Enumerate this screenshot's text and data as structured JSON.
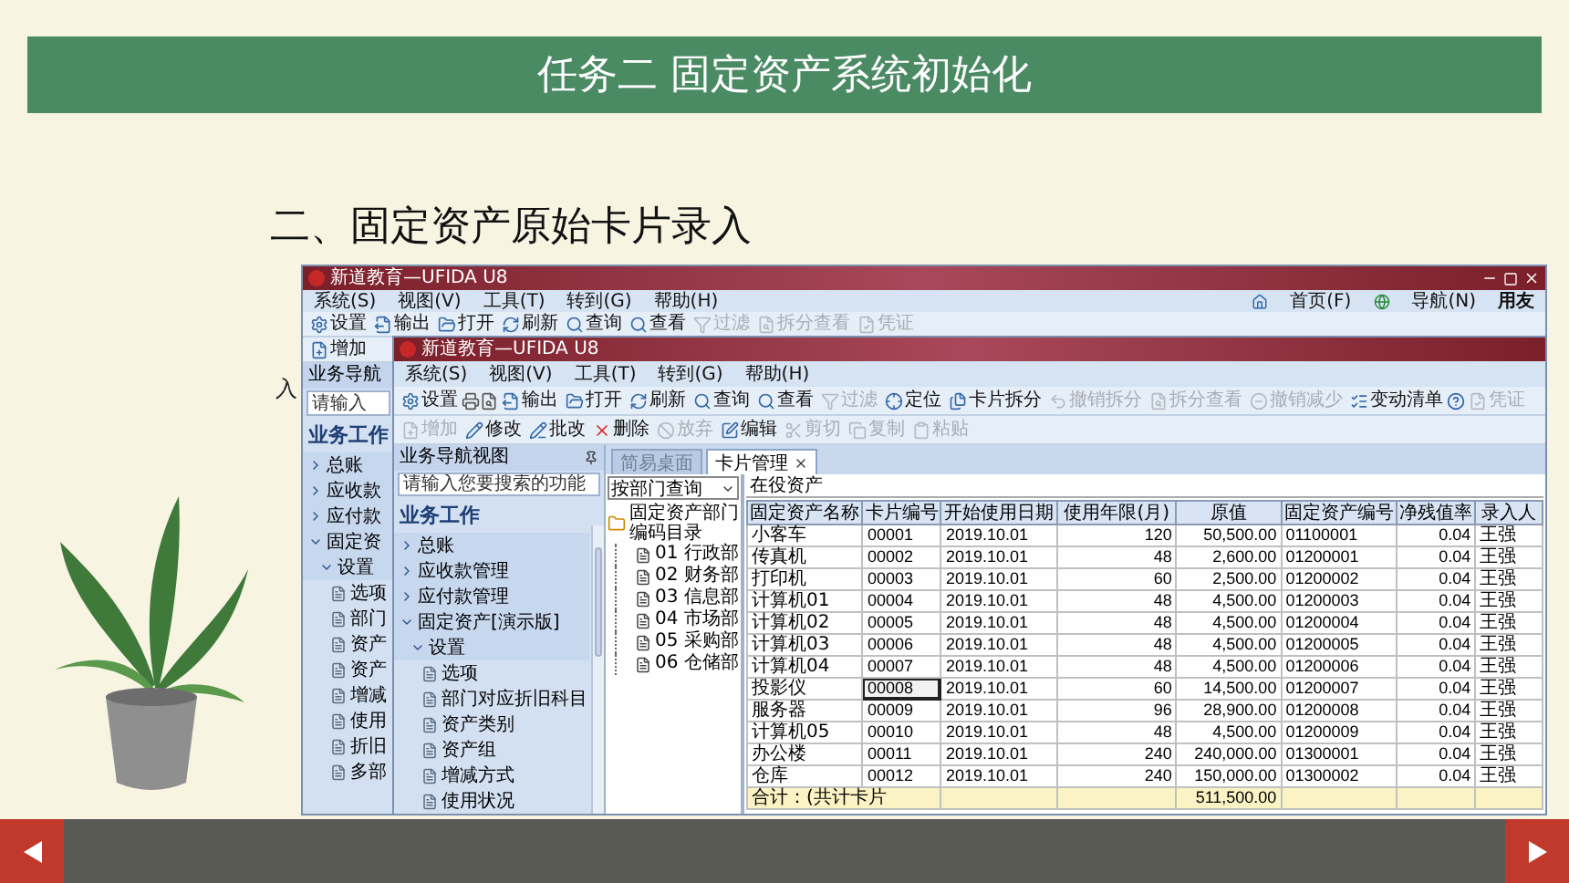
{
  "slide": {
    "title": "任务二 固定资产系统初始化",
    "heading": "二、固定资产原始卡片录入",
    "stray_text": "入"
  },
  "back_window": {
    "title": "新道教育—UFIDA U8",
    "menu": [
      "系统(S)",
      "视图(V)",
      "工具(T)",
      "转到(G)",
      "帮助(H)"
    ],
    "menu_right": [
      "首页(F)",
      "导航(N)",
      "用友"
    ],
    "toolbar": [
      {
        "label": "设置",
        "disabled": false
      },
      {
        "label": "输出",
        "disabled": false
      },
      {
        "label": "打开",
        "disabled": false
      },
      {
        "label": "刷新",
        "disabled": false
      },
      {
        "label": "查询",
        "disabled": false
      },
      {
        "label": "查看",
        "disabled": false
      },
      {
        "label": "过滤",
        "disabled": true
      },
      {
        "label": "拆分查看",
        "disabled": true
      },
      {
        "label": "凭证",
        "disabled": true
      }
    ],
    "toolbar2": [
      {
        "label": "增加",
        "disabled": false
      }
    ],
    "nav_header": "业务导航",
    "search_placeholder": "请输入",
    "section": "业务工作",
    "nav_items": [
      {
        "label": "总账",
        "expanded": false
      },
      {
        "label": "应收款",
        "expanded": false
      },
      {
        "label": "应付款",
        "expanded": false
      },
      {
        "label": "固定资",
        "expanded": true,
        "children": [
          {
            "label": "设置",
            "expanded": true,
            "children": [
              {
                "label": "选项"
              },
              {
                "label": "部门"
              },
              {
                "label": "资产"
              },
              {
                "label": "资产"
              },
              {
                "label": "增减"
              },
              {
                "label": "使用"
              },
              {
                "label": "折旧"
              },
              {
                "label": "多部"
              }
            ]
          }
        ]
      }
    ]
  },
  "front_window": {
    "title": "新道教育—UFIDA U8",
    "menu": [
      "系统(S)",
      "视图(V)",
      "工具(T)",
      "转到(G)",
      "帮助(H)"
    ],
    "toolbar": [
      {
        "label": "设置",
        "disabled": false
      },
      {
        "label": "输出",
        "disabled": false
      },
      {
        "label": "打开",
        "disabled": false
      },
      {
        "label": "刷新",
        "disabled": false
      },
      {
        "label": "查询",
        "disabled": false
      },
      {
        "label": "查看",
        "disabled": false
      },
      {
        "label": "过滤",
        "disabled": true
      },
      {
        "label": "定位",
        "disabled": false
      },
      {
        "label": "卡片拆分",
        "disabled": false
      },
      {
        "label": "撤销拆分",
        "disabled": true
      },
      {
        "label": "拆分查看",
        "disabled": true
      },
      {
        "label": "撤销减少",
        "disabled": true
      },
      {
        "label": "变动清单",
        "disabled": false
      },
      {
        "label": "凭证",
        "disabled": true
      }
    ],
    "toolbar2": [
      {
        "label": "增加",
        "disabled": true
      },
      {
        "label": "修改",
        "disabled": false
      },
      {
        "label": "批改",
        "disabled": false
      },
      {
        "label": "删除",
        "disabled": false
      },
      {
        "label": "放弃",
        "disabled": true
      },
      {
        "label": "编辑",
        "disabled": false
      },
      {
        "label": "剪切",
        "disabled": true
      },
      {
        "label": "复制",
        "disabled": true
      },
      {
        "label": "粘贴",
        "disabled": true
      }
    ],
    "nav": {
      "header": "业务导航视图",
      "search_placeholder": "请输入您要搜索的功能",
      "section": "业务工作",
      "items": [
        {
          "label": "总账",
          "expanded": false
        },
        {
          "label": "应收款管理",
          "expanded": false
        },
        {
          "label": "应付款管理",
          "expanded": false
        },
        {
          "label": "固定资产[演示版]",
          "expanded": true,
          "children": [
            {
              "label": "设置",
              "expanded": true,
              "children": [
                {
                  "label": "选项"
                },
                {
                  "label": "部门对应折旧科目"
                },
                {
                  "label": "资产类别"
                },
                {
                  "label": "资产组"
                },
                {
                  "label": "增减方式"
                },
                {
                  "label": "使用状况"
                }
              ]
            }
          ]
        }
      ]
    },
    "tabs": [
      {
        "label": "简易桌面",
        "selected": false
      },
      {
        "label": "卡片管理",
        "selected": true
      }
    ],
    "tree": {
      "query": "按部门查询",
      "root": "固定资产部门编码目录",
      "children": [
        "01 行政部",
        "02 财务部",
        "03 信息部",
        "04 市场部",
        "05 采购部",
        "06 仓储部"
      ]
    },
    "table": {
      "caption": "在役资产",
      "columns": [
        "固定资产名称",
        "卡片编号",
        "开始使用日期",
        "使用年限(月)",
        "原值",
        "固定资产编号",
        "净残值率",
        "录入人"
      ],
      "rows": [
        {
          "selected": false,
          "cells": [
            "小客车",
            "00001",
            "2019.10.01",
            "120",
            "50,500.00",
            "01100001",
            "0.04",
            "王强"
          ]
        },
        {
          "selected": false,
          "cells": [
            "传真机",
            "00002",
            "2019.10.01",
            "48",
            "2,600.00",
            "01200001",
            "0.04",
            "王强"
          ]
        },
        {
          "selected": false,
          "cells": [
            "打印机",
            "00003",
            "2019.10.01",
            "60",
            "2,500.00",
            "01200002",
            "0.04",
            "王强"
          ]
        },
        {
          "selected": false,
          "cells": [
            "计算机01",
            "00004",
            "2019.10.01",
            "48",
            "4,500.00",
            "01200003",
            "0.04",
            "王强"
          ]
        },
        {
          "selected": false,
          "cells": [
            "计算机02",
            "00005",
            "2019.10.01",
            "48",
            "4,500.00",
            "01200004",
            "0.04",
            "王强"
          ]
        },
        {
          "selected": false,
          "cells": [
            "计算机03",
            "00006",
            "2019.10.01",
            "48",
            "4,500.00",
            "01200005",
            "0.04",
            "王强"
          ]
        },
        {
          "selected": false,
          "cells": [
            "计算机04",
            "00007",
            "2019.10.01",
            "48",
            "4,500.00",
            "01200006",
            "0.04",
            "王强"
          ]
        },
        {
          "selected": true,
          "cells": [
            "投影仪",
            "00008",
            "2019.10.01",
            "60",
            "14,500.00",
            "01200007",
            "0.04",
            "王强"
          ]
        },
        {
          "selected": false,
          "cells": [
            "服务器",
            "00009",
            "2019.10.01",
            "96",
            "28,900.00",
            "01200008",
            "0.04",
            "王强"
          ]
        },
        {
          "selected": false,
          "cells": [
            "计算机05",
            "00010",
            "2019.10.01",
            "48",
            "4,500.00",
            "01200009",
            "0.04",
            "王强"
          ]
        },
        {
          "selected": false,
          "cells": [
            "办公楼",
            "00011",
            "2019.10.01",
            "240",
            "240,000.00",
            "01300001",
            "0.04",
            "王强"
          ]
        },
        {
          "selected": false,
          "cells": [
            "仓库",
            "00012",
            "2019.10.01",
            "240",
            "150,000.00",
            "01300002",
            "0.04",
            "王强"
          ]
        }
      ],
      "total": {
        "label": "合计：(共计卡片",
        "value": "511,500.00"
      }
    }
  }
}
